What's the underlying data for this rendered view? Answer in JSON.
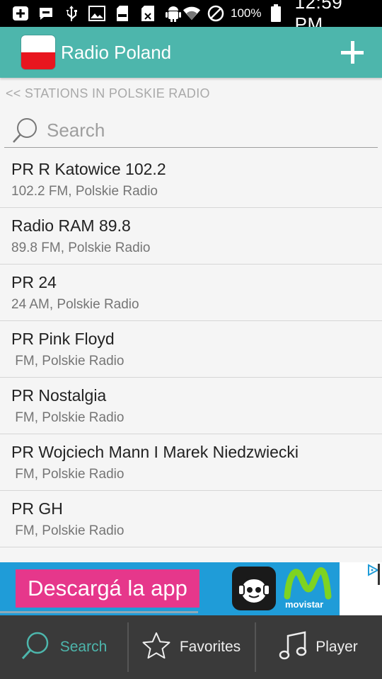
{
  "status_bar": {
    "icons": [
      "add-box-icon",
      "message-icon",
      "usb-icon",
      "image-icon",
      "sd-card-icon",
      "sim-off-icon",
      "android-debug-icon",
      "wifi-icon",
      "do-not-disturb-icon"
    ],
    "battery_percent": "100%",
    "time": "12:59 PM"
  },
  "app_bar": {
    "title": "Radio Poland",
    "flag_colors": [
      "#ffffff",
      "#e8161f"
    ],
    "accent_color": "#4db6ac"
  },
  "breadcrumb": "<< STATIONS IN POLSKIE RADIO",
  "search": {
    "placeholder": "Search",
    "value": ""
  },
  "stations": [
    {
      "name": "PR R Katowice 102.2",
      "detail": "102.2 FM, Polskie Radio"
    },
    {
      "name": "Radio RAM 89.8",
      "detail": "89.8 FM, Polskie Radio"
    },
    {
      "name": "PR 24",
      "detail": "24 AM, Polskie Radio"
    },
    {
      "name": "PR Pink Floyd",
      "detail": " FM, Polskie Radio"
    },
    {
      "name": "PR Nostalgia",
      "detail": " FM, Polskie Radio"
    },
    {
      "name": "PR Wojciech Mann I Marek Niedzwiecki",
      "detail": " FM, Polskie Radio"
    },
    {
      "name": "PR GH",
      "detail": " FM, Polskie Radio"
    }
  ],
  "ad": {
    "cta": "Descargá la app",
    "brand": "movistar",
    "colors": {
      "background": "#1f9cd8",
      "cta": "#e6378b"
    }
  },
  "bottom_nav": {
    "items": [
      {
        "label": "Search",
        "icon": "search-icon",
        "active": true
      },
      {
        "label": "Favorites",
        "icon": "star-icon",
        "active": false
      },
      {
        "label": "Player",
        "icon": "music-note-icon",
        "active": false
      }
    ]
  }
}
